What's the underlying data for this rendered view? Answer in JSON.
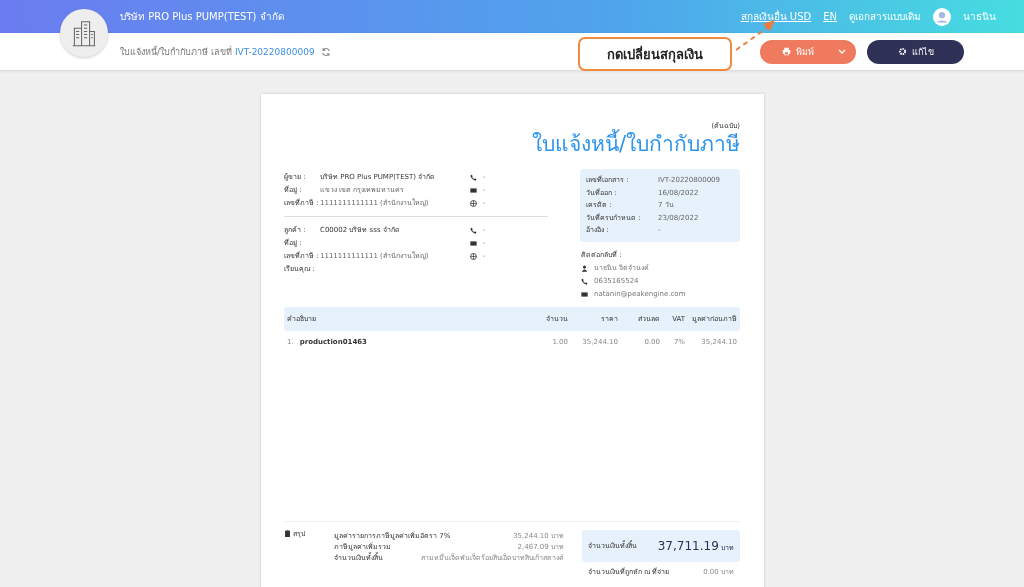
{
  "header": {
    "company": "บริษัท PRO Plus PUMP(TEST) จำกัด",
    "links": [
      "สกุลเงินอื่น USD",
      "EN",
      "ดูเอกสารแบบเดิม"
    ],
    "user": "นาธนิน"
  },
  "toolbar": {
    "breadcrumb": "ใบแจ้งหนี้/ใบกำกับภาษี เลขที่",
    "doc_no": "IVT-20220800009",
    "callout": "กดเปลี่ยนสกุลเงิน",
    "buttons": [
      {
        "label": "พิมพ์",
        "kind": "print"
      },
      {
        "label": "แก้ไข",
        "kind": "edit"
      }
    ]
  },
  "document": {
    "copy": "(ต้นฉบับ)",
    "title": "ใบแจ้งหนี้/ใบกำกับภาษี",
    "seller": [
      {
        "label": "ผู้ขาย :",
        "value": "บริษัท PRO Plus PUMP(TEST) จำกัด",
        "kind": "phone",
        "contact": "-"
      },
      {
        "label": "ที่อยู่ :",
        "value": "แขวง เขต กรุงเทพมหานคร",
        "kind": "mail",
        "contact": "-"
      },
      {
        "label": "เลขที่ภาษี :",
        "value": "1111111111111 (สำนักงานใหญ่)",
        "kind": "web",
        "contact": "-"
      }
    ],
    "customer": [
      {
        "label": "ลูกค้า :",
        "value": "C00002 บริษัท sss จำกัด",
        "kind": "phone",
        "contact": "-"
      },
      {
        "label": "ที่อยู่ :",
        "kind": "mail",
        "contact": "-"
      },
      {
        "label": "เลขที่ภาษี :",
        "value": "1111111111111 (สำนักงานใหญ่)",
        "kind": "web",
        "contact": "-"
      },
      {
        "label": "เรียนคุณ :"
      }
    ],
    "info": [
      {
        "label": "เลขที่เอกสาร :",
        "value": "IVT-20220800009"
      },
      {
        "label": "วันที่ออก :",
        "value": "16/08/2022"
      },
      {
        "label": "เครดิต :",
        "value": "7 วัน"
      },
      {
        "label": "วันที่ครบกำหนด :",
        "value": "23/08/2022"
      },
      {
        "label": "อ้างอิง :",
        "value": "-"
      }
    ],
    "contact_title": "ติดต่อกลับที่ :",
    "contacts": [
      {
        "kind": "person",
        "text": "นาธนิน จิตจำนงค์"
      },
      {
        "kind": "phone",
        "text": "0635165524"
      },
      {
        "kind": "mail",
        "text": "natanin@peakengine.com"
      }
    ],
    "table": {
      "columns": [
        "คำอธิบาย",
        "จำนวน",
        "ราคา",
        "ส่วนลด",
        "VAT",
        "มูลค่าก่อนภาษี"
      ],
      "rows": [
        {
          "number": "1.",
          "cells": [
            "production01463",
            "1.00",
            "35,244.10",
            "0.00",
            "7%",
            "35,244.10"
          ]
        }
      ]
    },
    "summary": {
      "title": "สรุป",
      "lines": [
        {
          "label": "มูลค่ารายการภาษีมูลค่าเพิ่มอัตรา 7%",
          "value": "35,244.10 บาท"
        },
        {
          "label": "ภาษีมูลค่าเพิ่มรวม",
          "value": "2,467.09 บาท"
        },
        {
          "label": "จำนวนเงินทั้งสิ้น",
          "value": "สามหมื่นเจ็ดพันเจ็ดร้อยสิบเอ็ดบาทสิบเก้าสตางค์"
        }
      ],
      "total_label": "จำนวนเงินทั้งสิ้น",
      "total": "37,711.19",
      "total_unit": "บาท",
      "withheld_label": "จำนวนเงินที่ถูกหัก ณ ที่จ่าย",
      "withheld": "0.00 บาท"
    }
  }
}
